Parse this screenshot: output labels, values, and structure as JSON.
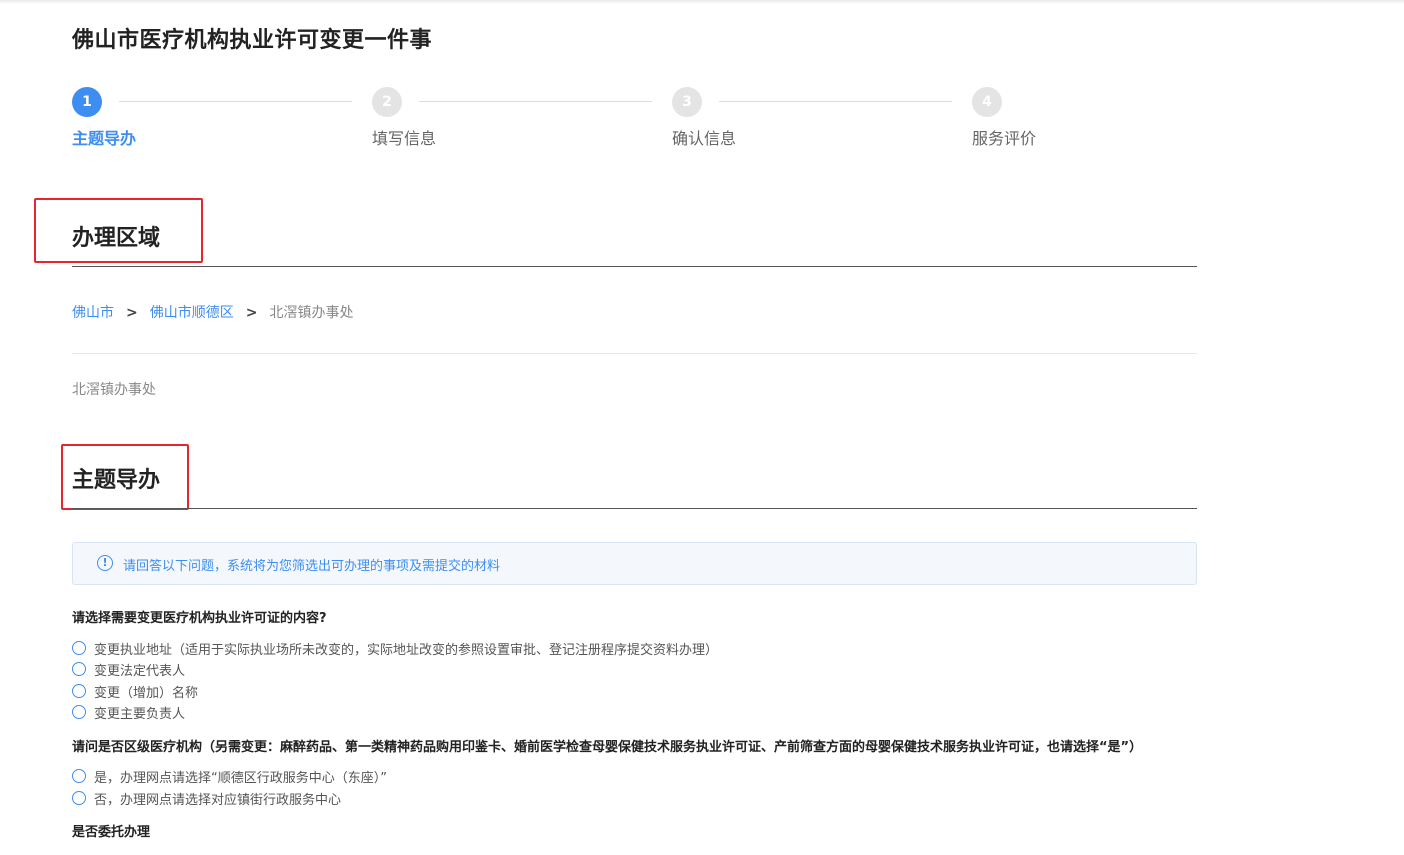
{
  "page": {
    "title": "佛山市医疗机构执业许可变更一件事"
  },
  "steps": [
    {
      "num": "1",
      "label": "主题导办"
    },
    {
      "num": "2",
      "label": "填写信息"
    },
    {
      "num": "3",
      "label": "确认信息"
    },
    {
      "num": "4",
      "label": "服务评价"
    }
  ],
  "region": {
    "title": "办理区域",
    "breadcrumb": [
      "佛山市",
      "佛山市顺德区",
      "北滘镇办事处"
    ],
    "separator": ">",
    "office": "北滘镇办事处"
  },
  "guide": {
    "title": "主题导办",
    "notice": "请回答以下问题，系统将为您筛选出可办理的事项及需提交的材料",
    "notice_icon": "info-icon",
    "questions": [
      {
        "text": "请选择需要变更医疗机构执业许可证的内容?",
        "options": [
          "变更执业地址（适用于实际执业场所未改变的，实际地址改变的参照设置审批、登记注册程序提交资料办理）",
          "变更法定代表人",
          "变更（增加）名称",
          "变更主要负责人"
        ]
      },
      {
        "text": "请问是否区级医疗机构（另需变更：麻醉药品、第一类精神药品购用印鉴卡、婚前医学检查母婴保健技术服务执业许可证、产前筛查方面的母婴保健技术服务执业许可证，也请选择“是”）",
        "options": [
          "是，办理网点请选择“顺德区行政服务中心（东座）”",
          "否，办理网点请选择对应镇街行政服务中心"
        ]
      },
      {
        "text": "是否委托办理",
        "options": []
      }
    ]
  },
  "colors": {
    "accent": "#3d8ef0",
    "highlight_box": "#e8252d"
  }
}
